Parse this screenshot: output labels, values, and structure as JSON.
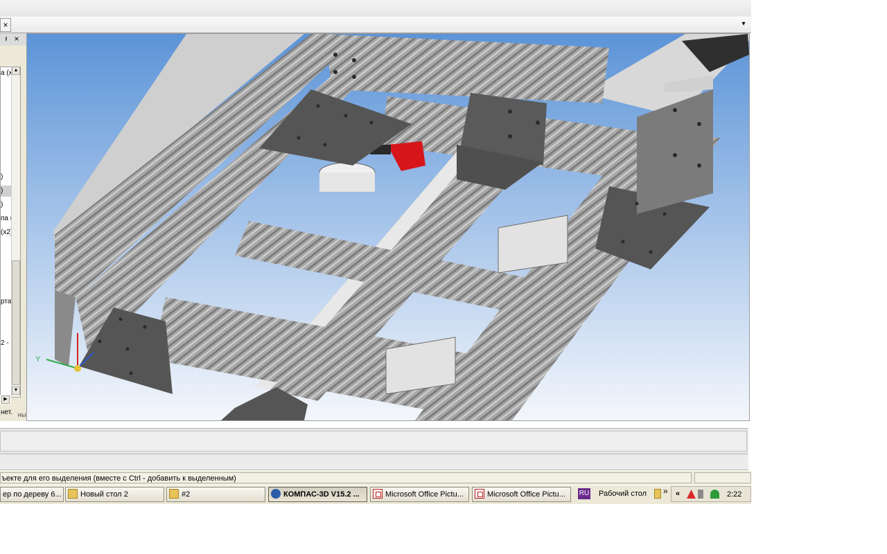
{
  "tab": {
    "close_symbol": "×",
    "dropdown_symbol": "▾"
  },
  "left_panel": {
    "pin_symbol": "ᵻ",
    "close_symbol": "×",
    "tree_items": [
      "а (x...",
      ")",
      ")",
      ")",
      "па (",
      "(x2)",
      "рта",
      "2 -",
      "нет."
    ],
    "bottom_label": "ны",
    "scroll_up": "▲",
    "scroll_down": "▼",
    "scroll_right": "▶"
  },
  "viewport": {
    "axis_y_label": "Y"
  },
  "status": {
    "hint": "ъекте для его выделения (вместе с Ctrl - добавить к выделенным)"
  },
  "taskbar": {
    "buttons": [
      {
        "label": "ер по дереву 6...",
        "icon": "none"
      },
      {
        "label": "Новый стол 2",
        "icon": "folder-icon"
      },
      {
        "label": "#2",
        "icon": "folder-icon"
      },
      {
        "label": "КОМПАС-3D V15.2 ...",
        "icon": "kompas-icon",
        "active": true
      },
      {
        "label": "Microsoft Office Pictu...",
        "icon": "picture-manager-icon"
      },
      {
        "label": "Microsoft Office Pictu...",
        "icon": "picture-manager-icon"
      }
    ],
    "language": "RU",
    "desktop_toolbar": "Рабочий стол",
    "quicklaunch_chevron": "»",
    "tray_collapse": "«",
    "clock": "2:22"
  },
  "colors": {
    "viewport_sky_top": "#5c94d8",
    "viewport_sky_bottom": "#f4f7fc",
    "profile": "#9a9a9a",
    "plate": "#555555",
    "accent_red": "#d6161b"
  }
}
